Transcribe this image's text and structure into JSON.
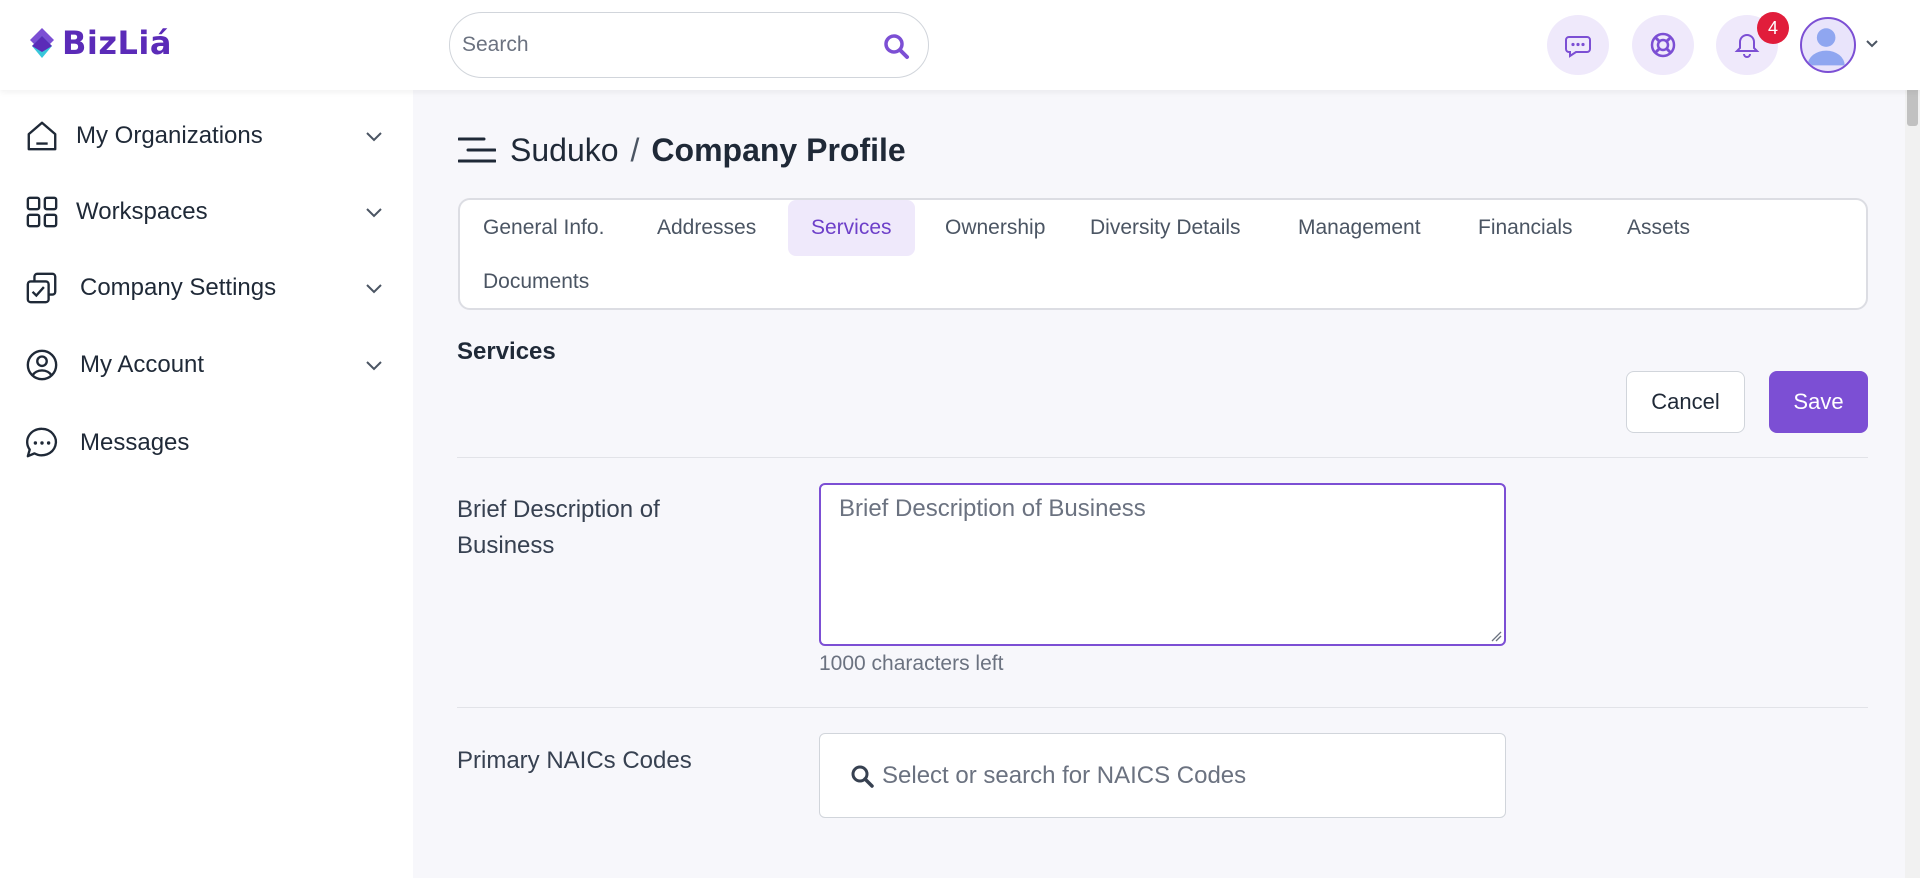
{
  "app": {
    "brand": "BizLiá",
    "accent": "#7c4fd4"
  },
  "header": {
    "search": {
      "placeholder": "Search"
    },
    "icons": [
      "chat-icon",
      "support-icon",
      "bell-icon"
    ],
    "notifications_count": "4"
  },
  "sidebar": {
    "items": [
      {
        "label": "My Organizations",
        "icon": "home-icon",
        "has_submenu": true
      },
      {
        "label": "Workspaces",
        "icon": "grid-icon",
        "has_submenu": true
      },
      {
        "label": "Company Settings",
        "icon": "settings-check-icon",
        "has_submenu": true
      },
      {
        "label": "My Account",
        "icon": "user-circle-icon",
        "has_submenu": true
      },
      {
        "label": "Messages",
        "icon": "message-icon",
        "has_submenu": false
      }
    ]
  },
  "breadcrumb": {
    "org": "Suduko",
    "separator": "/",
    "page": "Company Profile"
  },
  "tabs": [
    {
      "label": "General Info.",
      "active": false
    },
    {
      "label": "Addresses",
      "active": false
    },
    {
      "label": "Services",
      "active": true
    },
    {
      "label": "Ownership",
      "active": false
    },
    {
      "label": "Diversity Details",
      "active": false
    },
    {
      "label": "Management",
      "active": false
    },
    {
      "label": "Financials",
      "active": false
    },
    {
      "label": "Assets",
      "active": false
    },
    {
      "label": "Documents",
      "active": false
    }
  ],
  "section": {
    "title": "Services",
    "cancel_label": "Cancel",
    "save_label": "Save"
  },
  "form": {
    "description": {
      "label_line1": "Brief Description of",
      "label_line2": "Business",
      "placeholder": "Brief Description of Business",
      "value": "",
      "chars_left": "1000 characters left"
    },
    "naics": {
      "label": "Primary NAICs Codes",
      "placeholder": "Select or search for NAICS Codes"
    }
  }
}
